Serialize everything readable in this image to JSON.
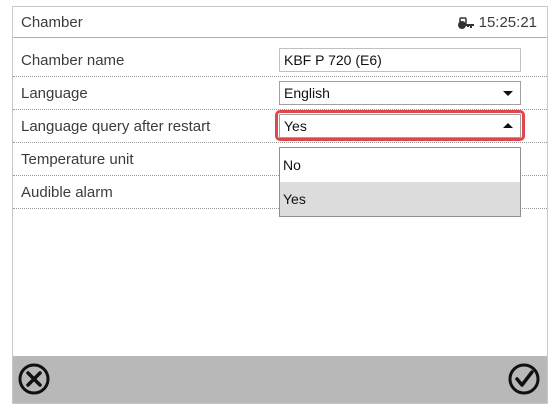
{
  "header": {
    "title": "Chamber",
    "time": "15:25:21",
    "lock_icon": "lock-icon"
  },
  "settings": [
    {
      "label": "Chamber name",
      "control": "text",
      "value": "KBF P 720 (E6)"
    },
    {
      "label": "Language",
      "control": "select",
      "value": "English"
    },
    {
      "label": "Language query after restart",
      "control": "select",
      "value": "Yes",
      "open": true
    },
    {
      "label": "Temperature unit",
      "control": "none"
    },
    {
      "label": "Audible alarm",
      "control": "none"
    }
  ],
  "dropdown": {
    "options": [
      "No",
      "Yes"
    ],
    "selected": "Yes"
  },
  "footer": {
    "cancel_icon": "cancel-circle-x-icon",
    "confirm_icon": "confirm-circle-check-icon"
  },
  "colors": {
    "focus_border": "#e0474c",
    "footer_bg": "#b8b8b8",
    "selected_option_bg": "#dcdcdc"
  }
}
